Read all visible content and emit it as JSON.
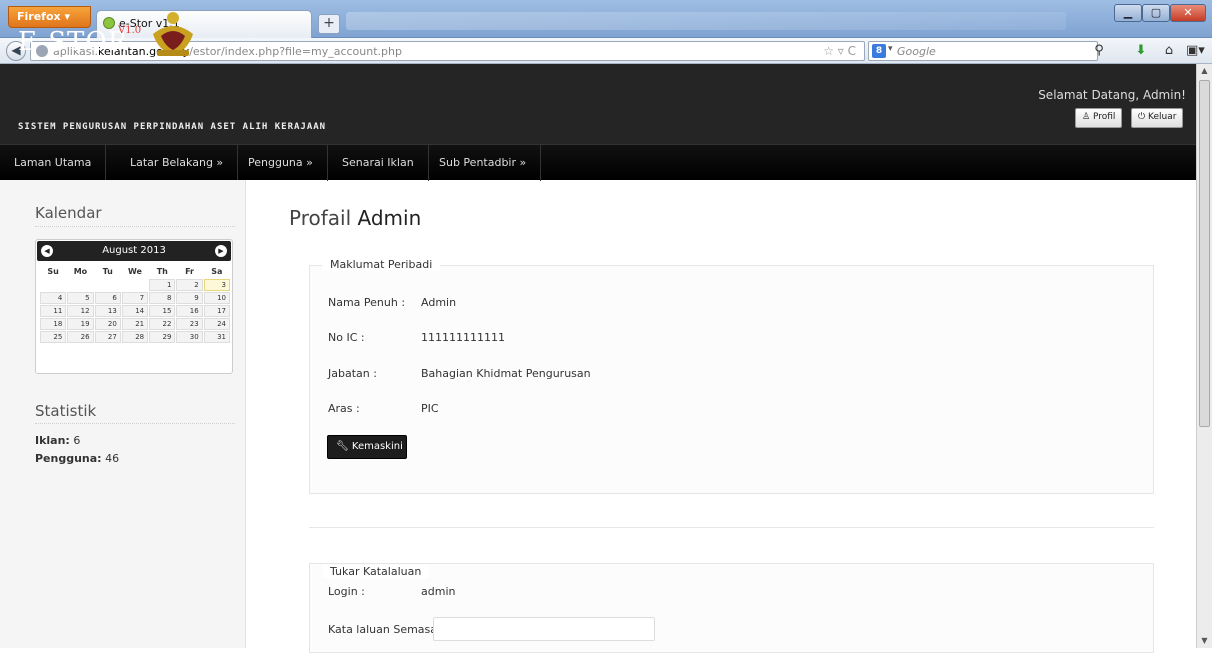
{
  "browser": {
    "menu_button": "Firefox",
    "tab_title": "e-Stor v1.1",
    "new_tab": "+",
    "url_prefix": "aplikasi.",
    "url_domain": "kelantan.gov.my",
    "url_path": "/estor/index.php?file=my_account.php",
    "search_placeholder": "Google",
    "search_engine_icon": "8"
  },
  "header": {
    "logo": "E-STOR",
    "version": "V1.0",
    "tagline": "SISTEM PENGURUSAN PERPINDAHAN ASET ALIH KERAJAAN",
    "welcome": "Selamat Datang, Admin!",
    "profile_button": "Profil",
    "logout_button": "Keluar"
  },
  "menu": {
    "items": [
      {
        "label": "Laman Utama"
      },
      {
        "label": "Latar Belakang »"
      },
      {
        "label": "Pengguna »"
      },
      {
        "label": "Senarai Iklan"
      },
      {
        "label": "Sub Pentadbir »"
      }
    ]
  },
  "sidebar": {
    "calendar_title": "Kalendar",
    "calendar": {
      "month": "August 2013",
      "weekdays": [
        "Su",
        "Mo",
        "Tu",
        "We",
        "Th",
        "Fr",
        "Sa"
      ],
      "weeks": [
        [
          "",
          "",
          "",
          "",
          "1",
          "2",
          "3"
        ],
        [
          "4",
          "5",
          "6",
          "7",
          "8",
          "9",
          "10"
        ],
        [
          "11",
          "12",
          "13",
          "14",
          "15",
          "16",
          "17"
        ],
        [
          "18",
          "19",
          "20",
          "21",
          "22",
          "23",
          "24"
        ],
        [
          "25",
          "26",
          "27",
          "28",
          "29",
          "30",
          "31"
        ]
      ],
      "today": "3"
    },
    "stats_title": "Statistik",
    "stats": {
      "iklan_label": "Iklan:",
      "iklan_value": "6",
      "pengguna_label": "Pengguna:",
      "pengguna_value": "46"
    }
  },
  "main": {
    "title_prefix": "Profail",
    "title_name": "Admin",
    "personal": {
      "legend": "Maklumat Peribadi",
      "fields": [
        {
          "label": "Nama Penuh :",
          "value": "Admin"
        },
        {
          "label": "No IC :",
          "value": "111111111111"
        },
        {
          "label": "Jabatan :",
          "value": "Bahagian Khidmat Pengurusan"
        },
        {
          "label": "Aras :",
          "value": "PIC"
        }
      ],
      "edit_button": "Kemaskini"
    },
    "password": {
      "legend": "Tukar Katalaluan",
      "login_label": "Login :",
      "login_value": "admin",
      "current_label": "Kata laluan Semasa:",
      "current_value": ""
    }
  },
  "colors": {
    "header_bg": "#252525",
    "menu_bg": "#000000",
    "version_red": "#e53a3a",
    "button_dark": "#1d1d1d"
  }
}
